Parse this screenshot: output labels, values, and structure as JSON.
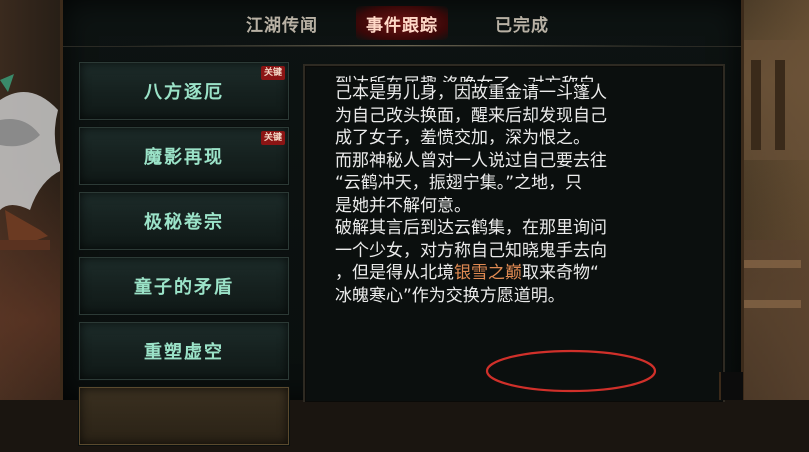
{
  "tabs": [
    {
      "label": "江湖传闻",
      "active": false
    },
    {
      "label": "事件跟踪",
      "active": true
    },
    {
      "label": "已完成",
      "active": false
    }
  ],
  "quests": [
    {
      "title": "八方逐厄",
      "key": "关键"
    },
    {
      "title": "魔影再现",
      "key": "关键"
    },
    {
      "title": "极秘卷宗",
      "key": ""
    },
    {
      "title": "童子的矛盾",
      "key": ""
    },
    {
      "title": "重塑虚空",
      "key": ""
    },
    {
      "title": "",
      "key": "",
      "selected": true
    }
  ],
  "story": {
    "line0": "到达所在居趣   洛晚女了，对方称自",
    "line1": "己本是男儿身，因故重金请一斗篷人",
    "line2": "为自己改头换面，醒来后却发现自己",
    "line3": "成了女子，羞愤交加，深为恨之。",
    "line4": "而那神秘人曾对一人说过自己要去往",
    "line5": "“云鹤冲天，振翅宁集。”之地，只",
    "line6": "是她并不解何意。",
    "line7": "破解其言后到达云鹤集，在那里询问",
    "line8": "一个少女，对方称自己知晓鬼手去向",
    "line9_a": "，但是得从北境",
    "line9_hl": "银雪之巅",
    "line9_b": "取来奇物“",
    "line10": "冰魄寒心”作为交换方愿道明。"
  },
  "colors": {
    "quest_text": "#9be3c8",
    "highlight_text": "#e08a52",
    "key_badge": "#8b1414",
    "annotation_circle": "#d0302a"
  }
}
